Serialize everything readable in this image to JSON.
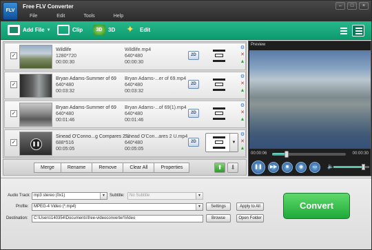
{
  "app": {
    "logo": "FLV",
    "title": "Free FLV Converter"
  },
  "menu": [
    "File",
    "Edit",
    "Tools",
    "Help"
  ],
  "window_buttons": [
    "–",
    "□",
    "×"
  ],
  "toolbar": {
    "add_file": "Add File",
    "clip": "Clip",
    "three_d": "3D",
    "three_d_icon": "3D",
    "edit": "Edit"
  },
  "files": [
    {
      "name": "Wildlife",
      "resolution": "1280*720",
      "duration": "00:00:30",
      "out_name": "Wildlife.mp4",
      "out_resolution": "640*480",
      "out_duration": "00:00:30",
      "checked": "✓",
      "mode": "2D"
    },
    {
      "name": "Bryan Adams-Summer of 69",
      "resolution": "640*480",
      "duration": "00:03:32",
      "out_name": "Bryan Adams-...er of 69.mp4",
      "out_resolution": "640*480",
      "out_duration": "00:03:32",
      "checked": "✓",
      "mode": "2D"
    },
    {
      "name": "Bryan Adams-Summer of 69",
      "resolution": "640*480",
      "duration": "00:01:46",
      "out_name": "Bryan Adams-...of 69(1).mp4",
      "out_resolution": "640*480",
      "out_duration": "00:01:46",
      "checked": "✓",
      "mode": "2D"
    },
    {
      "name": "Sinead O'Conno...g Compares 2 U",
      "resolution": "688*516",
      "duration": "00:05:05",
      "out_name": "Sinead O'Con...ares 2 U.mp4",
      "out_resolution": "640*480",
      "out_duration": "00:05:05",
      "checked": "✓",
      "mode": "2D"
    }
  ],
  "row_icons": {
    "settings": "⚙",
    "remove": "✕",
    "up": "▲",
    "down": "▼",
    "pause": "❚❚",
    "dropdown": "▼"
  },
  "list_buttons": [
    "Merge",
    "Rename",
    "Remove",
    "Clear All",
    "Properties"
  ],
  "move_buttons": {
    "up": "⬆",
    "down": "⬇"
  },
  "preview": {
    "label": "Preview",
    "time_current": "00:00:06",
    "time_total": "00:00:30",
    "progress": 0.2,
    "volume": 0.85,
    "controls": [
      "❚❚",
      "▶▶",
      "■",
      "◉",
      "▭"
    ],
    "speaker": "🔈"
  },
  "settings": {
    "audio_track_label": "Audio Track:",
    "audio_track_value": "mp3 stereo (0x1)",
    "subtitle_label": "Subtitle:",
    "subtitle_value": "No Subtitle",
    "profile_label": "Profile:",
    "profile_value": "MPEG-4 Video (*.mp4)",
    "destination_label": "Destination:",
    "destination_value": "C:\\Users\\140354\\Documents\\free-videoconverter\\Video",
    "settings_button": "Settings",
    "apply_all_button": "Apply to All",
    "browse_button": "Browse",
    "open_folder_button": "Open Folder",
    "dropdown_arrow": "▼",
    "convert_button": "Convert"
  }
}
